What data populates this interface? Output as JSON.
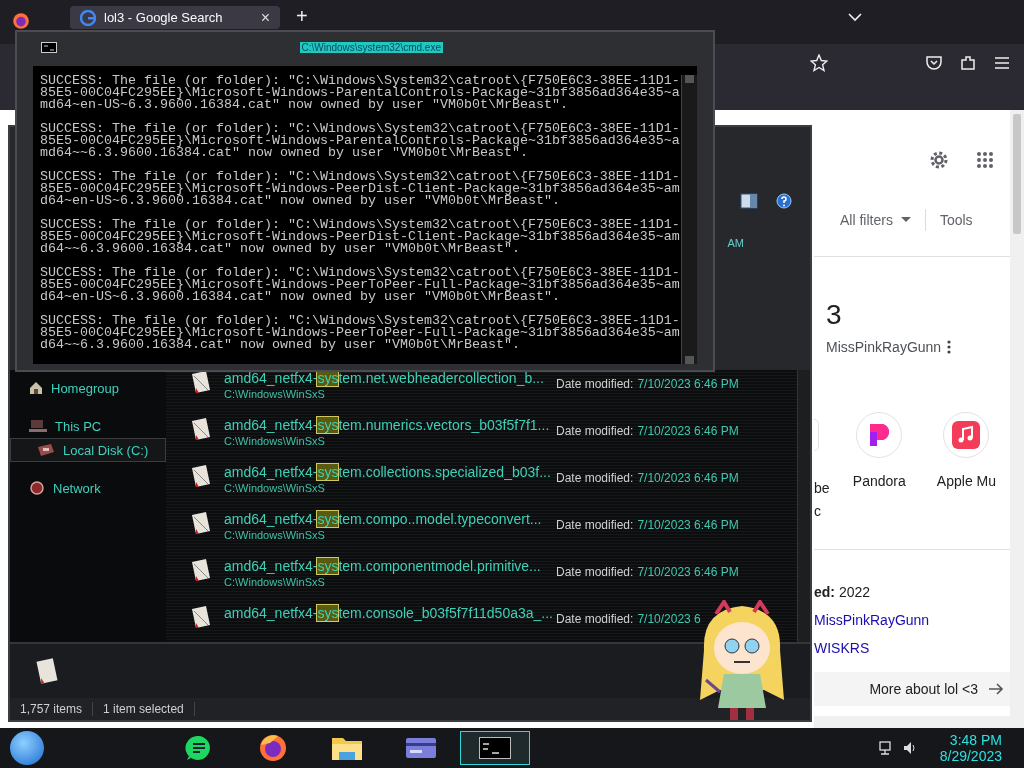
{
  "browser": {
    "tab_title": "lol3 - Google Search",
    "tab_close": "×",
    "new_tab": "+"
  },
  "google": {
    "filters": "All filters",
    "tools": "Tools",
    "result_title": "3",
    "result_author": "MissPinkRayGunn",
    "apps": [
      {
        "kind": "partial",
        "label_lines": [
          "be",
          "c"
        ]
      },
      {
        "kind": "pandora",
        "label_lines": [
          "Pandora"
        ]
      },
      {
        "kind": "apple-music",
        "label_lines": [
          "Apple Mu"
        ]
      }
    ],
    "released": "**ed:** 2022",
    "links": [
      "MissPinkRayGunn",
      "WISKRS"
    ],
    "more": "More about lol <3"
  },
  "explorer": {
    "partial_time": "AM",
    "nav": [
      {
        "label": "Homegroup",
        "kind": "homegroup",
        "selected": false
      },
      {
        "label": "This PC",
        "kind": "pc",
        "selected": false,
        "children": [
          {
            "label": "Local Disk (C:)",
            "kind": "disk",
            "selected": true
          }
        ]
      },
      {
        "label": "Network",
        "kind": "network",
        "selected": false
      }
    ],
    "files": [
      {
        "prefix": "amd64_netfx4-",
        "match": "sys",
        "rest": "tem.net.webheadercollection_b...",
        "path": "C:\\Windows\\WinSxS",
        "date_label": "Date modified:",
        "date": "7/10/2023 6:46 PM"
      },
      {
        "prefix": "amd64_netfx4-",
        "match": "sys",
        "rest": "tem.numerics.vectors_b03f5f7f1...",
        "path": "C:\\Windows\\WinSxS",
        "date_label": "Date modified:",
        "date": "7/10/2023 6:46 PM"
      },
      {
        "prefix": "amd64_netfx4-",
        "match": "sys",
        "rest": "tem.collections.specialized_b03f...",
        "path": "C:\\Windows\\WinSxS",
        "date_label": "Date modified:",
        "date": "7/10/2023 6:46 PM"
      },
      {
        "prefix": "amd64_netfx4-",
        "match": "sys",
        "rest": "tem.compo..model.typeconvert...",
        "path": "C:\\Windows\\WinSxS",
        "date_label": "Date modified:",
        "date": "7/10/2023 6:46 PM"
      },
      {
        "prefix": "amd64_netfx4-",
        "match": "sys",
        "rest": "tem.componentmodel.primitive...",
        "path": "C:\\Windows\\WinSxS",
        "date_label": "Date modified:",
        "date": "7/10/2023 6:46 PM"
      },
      {
        "prefix": "amd64_netfx4-",
        "match": "sys",
        "rest": "tem.console_b03f5f7f11d50a3a_...",
        "date_label": "Date modified:",
        "date": "7/10/2023 6"
      }
    ],
    "status_count": "1,757 items",
    "status_selection": "1 item selected"
  },
  "cmd": {
    "title": "C:\\Windows\\system32\\cmd.exe",
    "blocks": [
      [
        "SUCCESS: The file (or folder): \"C:\\Windows\\System32\\catroot\\{F750E6C3-38EE-11D1-",
        "85E5-00C04FC295EE}\\Microsoft-Windows-ParentalControls-Package~31bf3856ad364e35~a",
        "md64~en-US~6.3.9600.16384.cat\" now owned by user \"VM0b0t\\MrBeast\"."
      ],
      [
        "SUCCESS: The file (or folder): \"C:\\Windows\\System32\\catroot\\{F750E6C3-38EE-11D1-",
        "85E5-00C04FC295EE}\\Microsoft-Windows-ParentalControls-Package~31bf3856ad364e35~a",
        "md64~~6.3.9600.16384.cat\" now owned by user \"VM0b0t\\MrBeast\"."
      ],
      [
        "SUCCESS: The file (or folder): \"C:\\Windows\\System32\\catroot\\{F750E6C3-38EE-11D1-",
        "85E5-00C04FC295EE}\\Microsoft-Windows-PeerDist-Client-Package~31bf3856ad364e35~am",
        "d64~en-US~6.3.9600.16384.cat\" now owned by user \"VM0b0t\\MrBeast\"."
      ],
      [
        "SUCCESS: The file (or folder): \"C:\\Windows\\System32\\catroot\\{F750E6C3-38EE-11D1-",
        "85E5-00C04FC295EE}\\Microsoft-Windows-PeerDist-Client-Package~31bf3856ad364e35~am",
        "d64~~6.3.9600.16384.cat\" now owned by user \"VM0b0t\\MrBeast\"."
      ],
      [
        "SUCCESS: The file (or folder): \"C:\\Windows\\System32\\catroot\\{F750E6C3-38EE-11D1-",
        "85E5-00C04FC295EE}\\Microsoft-Windows-PeerToPeer-Full-Package~31bf3856ad364e35~am",
        "d64~en-US~6.3.9600.16384.cat\" now owned by user \"VM0b0t\\MrBeast\"."
      ],
      [
        "SUCCESS: The file (or folder): \"C:\\Windows\\System32\\catroot\\{F750E6C3-38EE-11D1-",
        "85E5-00C04FC295EE}\\Microsoft-Windows-PeerToPeer-Full-Package~31bf3856ad364e35~am",
        "d64~~6.3.9600.16384.cat\" now owned by user \"VM0b0t\\MrBeast\"."
      ]
    ]
  },
  "taskbar": {
    "apps": [
      {
        "kind": "chat",
        "selected": false
      },
      {
        "kind": "firefox",
        "selected": false
      },
      {
        "kind": "folder",
        "selected": false
      },
      {
        "kind": "card",
        "selected": false
      },
      {
        "kind": "cmd",
        "selected": true
      }
    ],
    "time": "3:48 PM",
    "date": "8/29/2023"
  }
}
